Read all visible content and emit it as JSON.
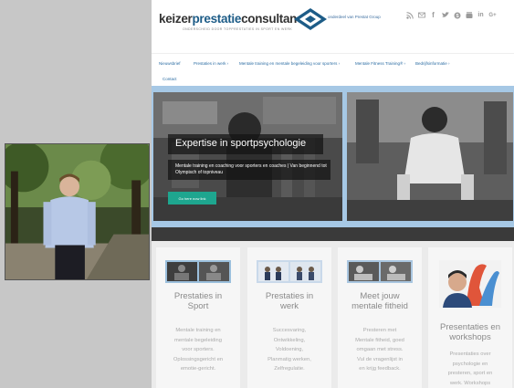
{
  "header": {
    "logo_part1": "keizer",
    "logo_part2": "prestatie",
    "logo_part3": "consultancy",
    "logo_tagline": "ONDERSCHEID DOOR TOPPRESTATIES IN SPORT EN WERK",
    "top_link": "onderdeel van Prestat Group",
    "social_icons": [
      "rss-icon",
      "mail-icon",
      "facebook-icon",
      "twitter-icon",
      "skype-icon",
      "youtube-icon",
      "linkedin-icon",
      "googleplus-icon"
    ]
  },
  "nav": {
    "items": [
      "Nieuwsbrief",
      "Prestaties in werk ›",
      "Mentale training en mentale begeleiding voor sporters ›",
      "Mentale Fitness Training® ›",
      "Bedrijfsinformatie ›",
      "Contact"
    ]
  },
  "hero": {
    "title": "Expertise in sportpsychologie",
    "text": "Mentale training en coaching voor sporters en coaches | Van beginnend tot Olympisch of topniveau",
    "button": "Go here now link"
  },
  "cards": [
    {
      "title_lines": [
        "Prestaties in",
        "Sport"
      ],
      "text_lines": [
        "Mentale training en",
        "mentale begeleiding",
        "voor sporters.",
        "Oplossingsgericht en",
        "emotie-gericht."
      ]
    },
    {
      "title_lines": [
        "Prestaties in",
        "werk"
      ],
      "text_lines": [
        "Succesvaring,",
        "Ontwikkeling,",
        "Voldoening,",
        "Planmatig werken,",
        "Zelfregulatie."
      ]
    },
    {
      "title_lines": [
        "Meet jouw",
        "mentale fitheid"
      ],
      "text_lines": [
        "Presteren met",
        "Mentale fitheid, goed",
        "omgaan met stress.",
        "Vul de vragenlijst in",
        "en krijg feedback."
      ]
    },
    {
      "title_lines": [
        "Presentaties en",
        "workshops"
      ],
      "text_lines": [
        "Presentaties over",
        "psychologie en",
        "presteren, sport en",
        "werk. Workshops"
      ]
    }
  ],
  "colors": {
    "brand_blue": "#1d5c87",
    "nav_link": "#2c6da3",
    "hero_frame": "#a6c8e5",
    "cta_green": "#1ea68f",
    "left_panel": "#c7c7c7"
  }
}
